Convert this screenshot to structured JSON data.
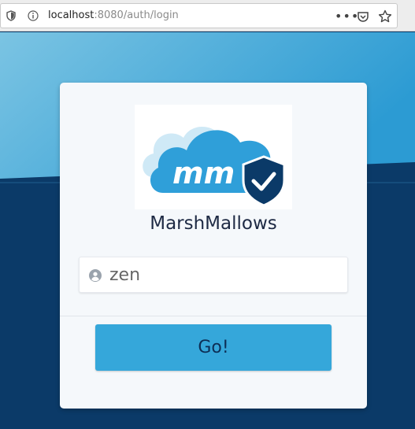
{
  "browser": {
    "url_host": "localhost",
    "url_rest": ":8080/auth/login",
    "more_label": "•••"
  },
  "colors": {
    "sky_light": "#6cc0e2",
    "sky_deep": "#2f9cd2",
    "navy": "#0b3a68",
    "card": "#f5f8fb",
    "button": "#35a7da",
    "button_text": "#0d2e55"
  },
  "logo": {
    "initials": "mm"
  },
  "login": {
    "brand": "MarshMallows",
    "username_value": "zen",
    "username_placeholder": "",
    "submit_label": "Go!"
  }
}
